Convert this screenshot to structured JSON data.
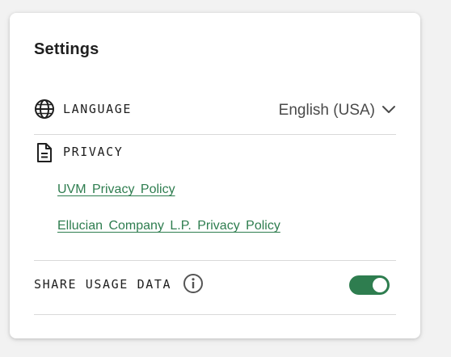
{
  "settings": {
    "title": "Settings",
    "language": {
      "label": "LANGUAGE",
      "icon": "globe-icon",
      "selected": "English (USA)",
      "dropdown_icon": "chevron-down-icon"
    },
    "privacy": {
      "label": "PRIVACY",
      "icon": "document-icon",
      "links": [
        "UVM Privacy Policy",
        "Ellucian Company L.P. Privacy Policy"
      ]
    },
    "share_usage": {
      "label": "SHARE USAGE DATA",
      "info_icon": "info-icon",
      "enabled": true
    }
  },
  "colors": {
    "accent": "#2e7d4f",
    "divider": "#d9d9d9",
    "text": "#1f1f1f"
  }
}
